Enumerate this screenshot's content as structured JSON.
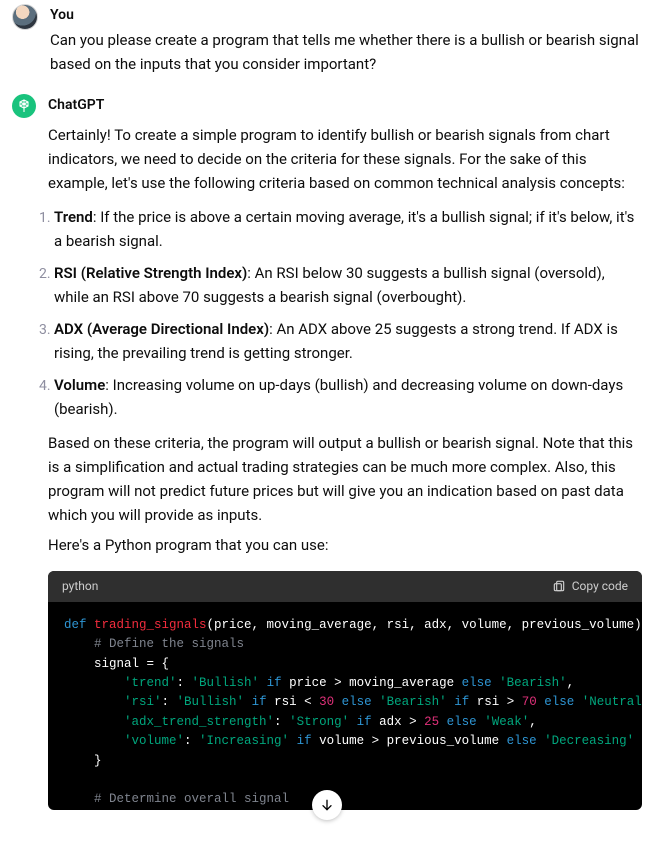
{
  "user": {
    "role_label": "You",
    "message": "Can you please create a program that tells me whether there is a bullish or bearish signal based on the inputs that you consider important?"
  },
  "assistant": {
    "role_label": "ChatGPT",
    "intro": "Certainly! To create a simple program to identify bullish or bearish signals from chart indicators, we need to decide on the criteria for these signals. For the sake of this example, let's use the following criteria based on common technical analysis concepts:",
    "criteria": [
      {
        "name": "Trend",
        "desc": ": If the price is above a certain moving average, it's a bullish signal; if it's below, it's a bearish signal."
      },
      {
        "name": "RSI (Relative Strength Index)",
        "desc": ": An RSI below 30 suggests a bullish signal (oversold), while an RSI above 70 suggests a bearish signal (overbought)."
      },
      {
        "name": "ADX (Average Directional Index)",
        "desc": ": An ADX above 25 suggests a strong trend. If ADX is rising, the prevailing trend is getting stronger."
      },
      {
        "name": "Volume",
        "desc": ": Increasing volume on up-days (bullish) and decreasing volume on down-days (bearish)."
      }
    ],
    "note": "Based on these criteria, the program will output a bullish or bearish signal. Note that this is a simplification and actual trading strategies can be much more complex. Also, this program will not predict future prices but will give you an indication based on past data which you will provide as inputs.",
    "lead_in": "Here's a Python program that you can use:"
  },
  "code": {
    "language": "python",
    "copy_label": "Copy code",
    "lines": {
      "l1_def": "def",
      "l1_fn": " trading_signals",
      "l1_rest": "(price, moving_average, rsi, adx, volume, previous_volume):",
      "l2": "    # Define the signals",
      "l3": "    signal = {",
      "l4a": "        ",
      "l4s1": "'trend'",
      "l4b": ": ",
      "l4s2": "'Bullish'",
      "l4c": " ",
      "l4kw": "if",
      "l4d": " price > moving_average ",
      "l4kw2": "else",
      "l4e": " ",
      "l4s3": "'Bearish'",
      "l4f": ",",
      "l5a": "        ",
      "l5s1": "'rsi'",
      "l5b": ": ",
      "l5s2": "'Bullish'",
      "l5c": " ",
      "l5kw": "if",
      "l5d": " rsi < ",
      "l5n1": "30",
      "l5e": " ",
      "l5kw2": "else",
      "l5f": " ",
      "l5s3": "'Bearish'",
      "l5g": " ",
      "l5kw3": "if",
      "l5h": " rsi > ",
      "l5n2": "70",
      "l5i": " ",
      "l5kw4": "else",
      "l5j": " ",
      "l5s4": "'Neutral'",
      "l5k": ",",
      "l6a": "        ",
      "l6s1": "'adx_trend_strength'",
      "l6b": ": ",
      "l6s2": "'Strong'",
      "l6c": " ",
      "l6kw": "if",
      "l6d": " adx > ",
      "l6n": "25",
      "l6e": " ",
      "l6kw2": "else",
      "l6f": " ",
      "l6s3": "'Weak'",
      "l6g": ",",
      "l7a": "        ",
      "l7s1": "'volume'",
      "l7b": ": ",
      "l7s2": "'Increasing'",
      "l7c": " ",
      "l7kw": "if",
      "l7d": " volume > previous_volume ",
      "l7kw2": "else",
      "l7e": " ",
      "l7s3": "'Decreasing'",
      "l8": "    }",
      "l9": "",
      "l10": "    # Determine overall signal"
    }
  }
}
